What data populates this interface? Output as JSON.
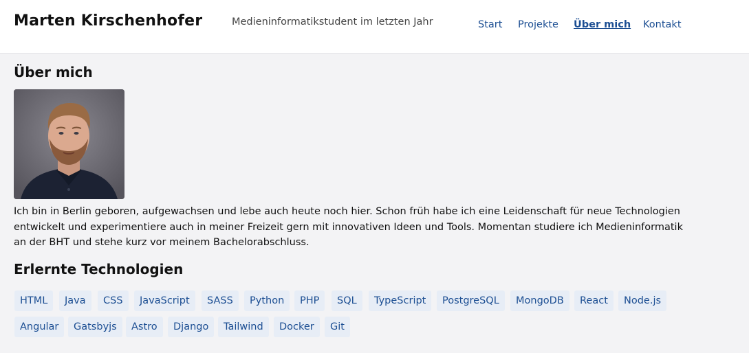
{
  "header": {
    "name": "Marten Kirschenhofer",
    "subtitle": "Medieninformatikstudent im letzten Jahr",
    "nav": [
      {
        "label": "Start",
        "active": false
      },
      {
        "label": "Projekte",
        "active": false
      },
      {
        "label": "Über mich",
        "active": true
      },
      {
        "label": "Kontakt",
        "active": false
      }
    ]
  },
  "about": {
    "heading": "Über mich",
    "photo_alt": "Portrait photo",
    "bio": "Ich bin in Berlin geboren, aufgewachsen und lebe auch heute noch hier. Schon früh habe ich eine Leidenschaft für neue Technologien entwickelt und experimentiere auch in meiner Freizeit gern mit innovativen Ideen und Tools. Momentan studiere ich Medieninformatik an der BHT und stehe kurz vor meinem Bachelorabschluss."
  },
  "technologies": {
    "heading": "Erlernte Technologien",
    "tags": [
      "HTML",
      "Java",
      "CSS",
      "JavaScript",
      "SASS",
      "Python",
      "PHP",
      "SQL",
      "TypeScript",
      "PostgreSQL",
      "MongoDB",
      "React",
      "Node.js",
      "Angular",
      "Gatsbyjs",
      "Astro",
      "Django",
      "Tailwind",
      "Docker",
      "Git"
    ]
  },
  "colors": {
    "accent": "#1d4f93",
    "tag_bg": "#e7edf6",
    "page_bg": "#f3f3f5"
  }
}
